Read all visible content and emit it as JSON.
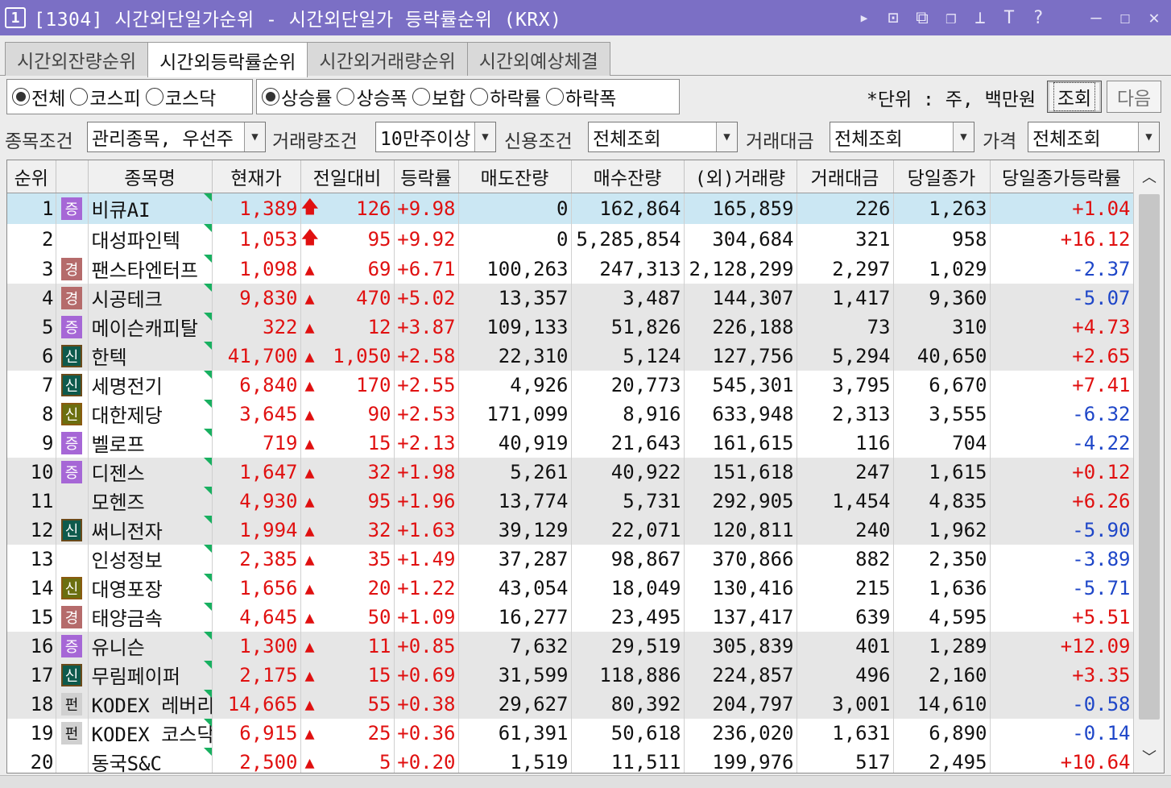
{
  "window": {
    "number": "1",
    "title": "[1304] 시간외단일가순위 - 시간외단일가 등락률순위 (KRX)",
    "icons": [
      "play-icon",
      "m-icon",
      "layout-icon",
      "copy-window-icon",
      "pin-icon",
      "text-icon",
      "help-icon",
      "minimize-icon",
      "maximize-icon",
      "close-icon"
    ]
  },
  "tabs": [
    {
      "label": "시간외잔량순위",
      "active": false
    },
    {
      "label": "시간외등락률순위",
      "active": true
    },
    {
      "label": "시간외거래량순위",
      "active": false
    },
    {
      "label": "시간외예상체결",
      "active": false
    }
  ],
  "market_radios": [
    {
      "label": "전체",
      "checked": true
    },
    {
      "label": "코스피",
      "checked": false
    },
    {
      "label": "코스닥",
      "checked": false
    }
  ],
  "sort_radios": [
    {
      "label": "상승률",
      "checked": true
    },
    {
      "label": "상승폭",
      "checked": false
    },
    {
      "label": "보합",
      "checked": false
    },
    {
      "label": "하락률",
      "checked": false
    },
    {
      "label": "하락폭",
      "checked": false
    }
  ],
  "unit_text": "*단위 : 주, 백만원",
  "buttons": {
    "search": "조회",
    "next": "다음"
  },
  "conditions": {
    "stock_label": "종목조건",
    "stock_value": "관리종목, 우선주",
    "volume_label": "거래량조건",
    "volume_value": "10만주이상",
    "credit_label": "신용조건",
    "credit_value": "전체조회",
    "amount_label": "거래대금",
    "amount_value": "전체조회",
    "price_label": "가격",
    "price_value": "전체조회"
  },
  "table": {
    "headers": [
      "순위",
      "",
      "종목명",
      "현재가",
      "전일대비",
      "등락률",
      "매도잔량",
      "매수잔량",
      "(외)거래량",
      "거래대금",
      "당일종가",
      "당일종가등락률"
    ],
    "rows": [
      {
        "rank": "1",
        "badge": "증",
        "name": "비큐AI",
        "price": "1,389",
        "arrow": "up-limit",
        "change": "126",
        "rate": "+9.98",
        "sell": "0",
        "buy": "162,864",
        "volume": "165,859",
        "amount": "226",
        "close": "1,263",
        "close_rate": "+1.04"
      },
      {
        "rank": "2",
        "badge": "",
        "name": "대성파인텍",
        "price": "1,053",
        "arrow": "up-limit",
        "change": "95",
        "rate": "+9.92",
        "sell": "0",
        "buy": "5,285,854",
        "volume": "304,684",
        "amount": "321",
        "close": "958",
        "close_rate": "+16.12"
      },
      {
        "rank": "3",
        "badge": "경",
        "name": "팬스타엔터프",
        "price": "1,098",
        "arrow": "up",
        "change": "69",
        "rate": "+6.71",
        "sell": "100,263",
        "buy": "247,313",
        "volume": "2,128,299",
        "amount": "2,297",
        "close": "1,029",
        "close_rate": "-2.37"
      },
      {
        "rank": "4",
        "badge": "경",
        "name": "시공테크",
        "price": "9,830",
        "arrow": "up",
        "change": "470",
        "rate": "+5.02",
        "sell": "13,357",
        "buy": "3,487",
        "volume": "144,307",
        "amount": "1,417",
        "close": "9,360",
        "close_rate": "-5.07"
      },
      {
        "rank": "5",
        "badge": "증",
        "name": "메이슨캐피탈",
        "price": "322",
        "arrow": "up",
        "change": "12",
        "rate": "+3.87",
        "sell": "109,133",
        "buy": "51,826",
        "volume": "226,188",
        "amount": "73",
        "close": "310",
        "close_rate": "+4.73"
      },
      {
        "rank": "6",
        "badge": "신",
        "name": "한텍",
        "price": "41,700",
        "arrow": "up",
        "change": "1,050",
        "rate": "+2.58",
        "sell": "22,310",
        "buy": "5,124",
        "volume": "127,756",
        "amount": "5,294",
        "close": "40,650",
        "close_rate": "+2.65"
      },
      {
        "rank": "7",
        "badge": "신",
        "name": "세명전기",
        "price": "6,840",
        "arrow": "up",
        "change": "170",
        "rate": "+2.55",
        "sell": "4,926",
        "buy": "20,773",
        "volume": "545,301",
        "amount": "3,795",
        "close": "6,670",
        "close_rate": "+7.41"
      },
      {
        "rank": "8",
        "badge": "신2",
        "name": "대한제당",
        "price": "3,645",
        "arrow": "up",
        "change": "90",
        "rate": "+2.53",
        "sell": "171,099",
        "buy": "8,916",
        "volume": "633,948",
        "amount": "2,313",
        "close": "3,555",
        "close_rate": "-6.32"
      },
      {
        "rank": "9",
        "badge": "증",
        "name": "벨로프",
        "price": "719",
        "arrow": "up",
        "change": "15",
        "rate": "+2.13",
        "sell": "40,919",
        "buy": "21,643",
        "volume": "161,615",
        "amount": "116",
        "close": "704",
        "close_rate": "-4.22"
      },
      {
        "rank": "10",
        "badge": "증",
        "name": "디젠스",
        "price": "1,647",
        "arrow": "up",
        "change": "32",
        "rate": "+1.98",
        "sell": "5,261",
        "buy": "40,922",
        "volume": "151,618",
        "amount": "247",
        "close": "1,615",
        "close_rate": "+0.12"
      },
      {
        "rank": "11",
        "badge": "",
        "name": "모헨즈",
        "price": "4,930",
        "arrow": "up",
        "change": "95",
        "rate": "+1.96",
        "sell": "13,774",
        "buy": "5,731",
        "volume": "292,905",
        "amount": "1,454",
        "close": "4,835",
        "close_rate": "+6.26"
      },
      {
        "rank": "12",
        "badge": "신",
        "name": "써니전자",
        "price": "1,994",
        "arrow": "up",
        "change": "32",
        "rate": "+1.63",
        "sell": "39,129",
        "buy": "22,071",
        "volume": "120,811",
        "amount": "240",
        "close": "1,962",
        "close_rate": "-5.90"
      },
      {
        "rank": "13",
        "badge": "",
        "name": "인성정보",
        "price": "2,385",
        "arrow": "up",
        "change": "35",
        "rate": "+1.49",
        "sell": "37,287",
        "buy": "98,867",
        "volume": "370,866",
        "amount": "882",
        "close": "2,350",
        "close_rate": "-3.89"
      },
      {
        "rank": "14",
        "badge": "신2",
        "name": "대영포장",
        "price": "1,656",
        "arrow": "up",
        "change": "20",
        "rate": "+1.22",
        "sell": "43,054",
        "buy": "18,049",
        "volume": "130,416",
        "amount": "215",
        "close": "1,636",
        "close_rate": "-5.71"
      },
      {
        "rank": "15",
        "badge": "경",
        "name": "태양금속",
        "price": "4,645",
        "arrow": "up",
        "change": "50",
        "rate": "+1.09",
        "sell": "16,277",
        "buy": "23,495",
        "volume": "137,417",
        "amount": "639",
        "close": "4,595",
        "close_rate": "+5.51"
      },
      {
        "rank": "16",
        "badge": "증",
        "name": "유니슨",
        "price": "1,300",
        "arrow": "up",
        "change": "11",
        "rate": "+0.85",
        "sell": "7,632",
        "buy": "29,519",
        "volume": "305,839",
        "amount": "401",
        "close": "1,289",
        "close_rate": "+12.09"
      },
      {
        "rank": "17",
        "badge": "신",
        "name": "무림페이퍼",
        "price": "2,175",
        "arrow": "up",
        "change": "15",
        "rate": "+0.69",
        "sell": "31,599",
        "buy": "118,886",
        "volume": "224,857",
        "amount": "496",
        "close": "2,160",
        "close_rate": "+3.35"
      },
      {
        "rank": "18",
        "badge": "펀",
        "name": "KODEX 레버리",
        "price": "14,665",
        "arrow": "up",
        "change": "55",
        "rate": "+0.38",
        "sell": "29,627",
        "buy": "80,392",
        "volume": "204,797",
        "amount": "3,001",
        "close": "14,610",
        "close_rate": "-0.58"
      },
      {
        "rank": "19",
        "badge": "펀",
        "name": "KODEX 코스닥",
        "price": "6,915",
        "arrow": "up",
        "change": "25",
        "rate": "+0.36",
        "sell": "61,391",
        "buy": "50,618",
        "volume": "236,020",
        "amount": "1,631",
        "close": "6,890",
        "close_rate": "-0.14"
      },
      {
        "rank": "20",
        "badge": "",
        "name": "동국S&C",
        "price": "2,500",
        "arrow": "up",
        "change": "5",
        "rate": "+0.20",
        "sell": "1,519",
        "buy": "11,511",
        "volume": "199,976",
        "amount": "517",
        "close": "2,495",
        "close_rate": "+10.64"
      }
    ],
    "shaded_rows": [
      4,
      5,
      6,
      10,
      11,
      12,
      16,
      17,
      18
    ],
    "selected_row": 1
  },
  "colors": {
    "title_bar": "#7b6fc5",
    "up": "#e01010",
    "down": "#1e46c8",
    "selected": "#cbe7f3"
  }
}
